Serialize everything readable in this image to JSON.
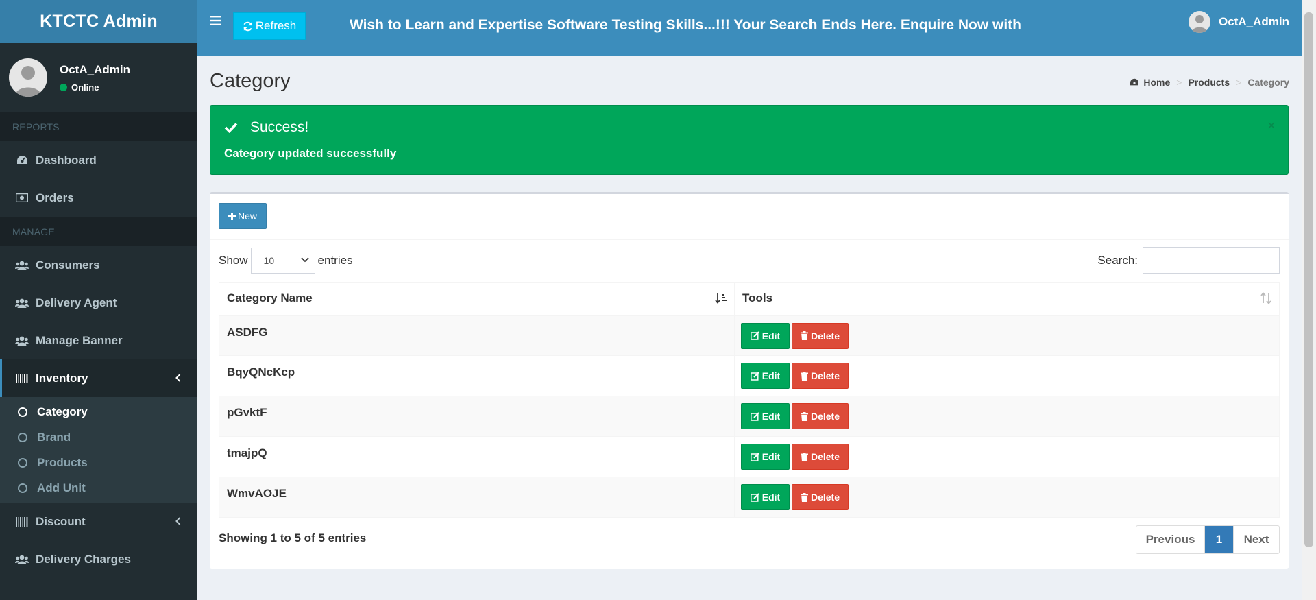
{
  "app": {
    "logo": "KTCTC Admin"
  },
  "user": {
    "name": "OctA_Admin",
    "status": "Online"
  },
  "sidebar": {
    "sections": [
      {
        "header": "REPORTS"
      },
      {
        "header": "MANAGE"
      }
    ],
    "reports_items": [
      {
        "label": "Dashboard",
        "icon": "dashboard-icon"
      },
      {
        "label": "Orders",
        "icon": "money-icon"
      }
    ],
    "manage_items": [
      {
        "label": "Consumers",
        "icon": "users-icon"
      },
      {
        "label": "Delivery Agent",
        "icon": "users-icon"
      },
      {
        "label": "Manage Banner",
        "icon": "users-icon"
      }
    ],
    "inventory": {
      "label": "Inventory",
      "sub": [
        "Category",
        "Brand",
        "Products",
        "Add Unit"
      ]
    },
    "discount": {
      "label": "Discount"
    },
    "delivery": {
      "label": "Delivery Charges"
    }
  },
  "header": {
    "refresh_label": "Refresh",
    "marquee": "Wish to Learn and Expertise Software Testing Skills...!!! Your Search Ends Here. Enquire Now with"
  },
  "page": {
    "title": "Category",
    "breadcrumb": [
      "Home",
      "Products",
      "Category"
    ]
  },
  "alert": {
    "title": "Success!",
    "message": "Category updated successfully",
    "close": "×"
  },
  "box": {
    "new_label": "New",
    "show_label": "Show",
    "entries_value": "10",
    "entries_label": "entries",
    "search_label": "Search:",
    "search_value": ""
  },
  "table": {
    "columns": [
      "Category Name",
      "Tools"
    ],
    "rows": [
      {
        "name": "ASDFG"
      },
      {
        "name": "BqyQNcKcp"
      },
      {
        "name": "pGvktF"
      },
      {
        "name": "tmajpQ"
      },
      {
        "name": "WmvAOJE"
      }
    ],
    "edit_label": "Edit",
    "delete_label": "Delete"
  },
  "footer": {
    "info": "Showing 1 to 5 of 5 entries",
    "prev": "Previous",
    "current": "1",
    "next": "Next"
  },
  "colors": {
    "header": "#3c8dbc",
    "sidebar": "#222d32",
    "success": "#00a65a",
    "danger": "#dd4b39",
    "info": "#00c0ef"
  }
}
